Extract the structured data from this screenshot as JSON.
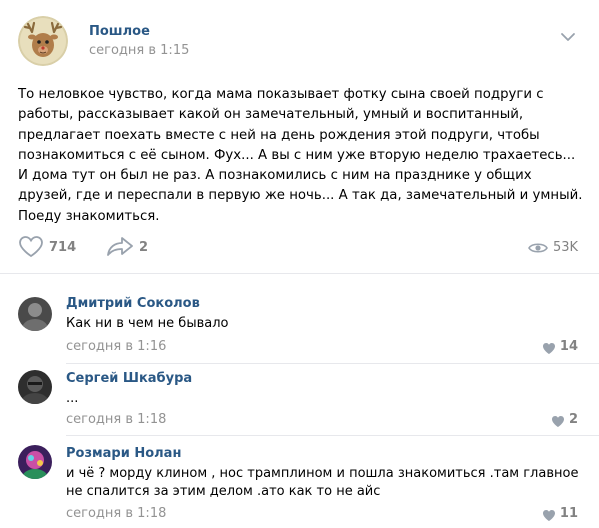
{
  "post": {
    "author": "Пошлое",
    "time": "сегодня в 1:15",
    "text": "То неловкое чувство, когда мама показывает фотку сына своей подруги с работы, рассказывает какой он замечательный, умный и воспитанный, предлагает поехать вместе с ней на день рождения этой подруги, чтобы познакомиться с её сыном. Фух... А вы с ним уже вторую неделю трахаетесь... И дома тут он был не раз. А познакомились с ним на празднике у общих друзей, где и переспали в первую же ночь... А так да, замечательный и умный. Поеду знакомиться.",
    "likes": "714",
    "shares": "2",
    "views": "53K"
  },
  "comments": [
    {
      "author": "Дмитрий Соколов",
      "text": "Как ни в чем не бывало",
      "time": "сегодня в 1:16",
      "likes": "14"
    },
    {
      "author": "Сергей Шкабура",
      "text": "...",
      "time": "сегодня в 1:18",
      "likes": "2"
    },
    {
      "author": "Розмари Нолан",
      "text": "и чё ? морду клином , нос трамплином и пошла знакомиться .там главное не спалится за этим делом .ато как то не айс",
      "time": "сегодня в 1:18",
      "likes": "11"
    }
  ],
  "icons": {
    "more": "chevron-down-icon",
    "like": "heart-icon",
    "share": "share-arrow-icon",
    "views": "eye-icon"
  },
  "colors": {
    "link": "#2a5885",
    "muted": "#939393",
    "icon": "#99a2ad"
  }
}
